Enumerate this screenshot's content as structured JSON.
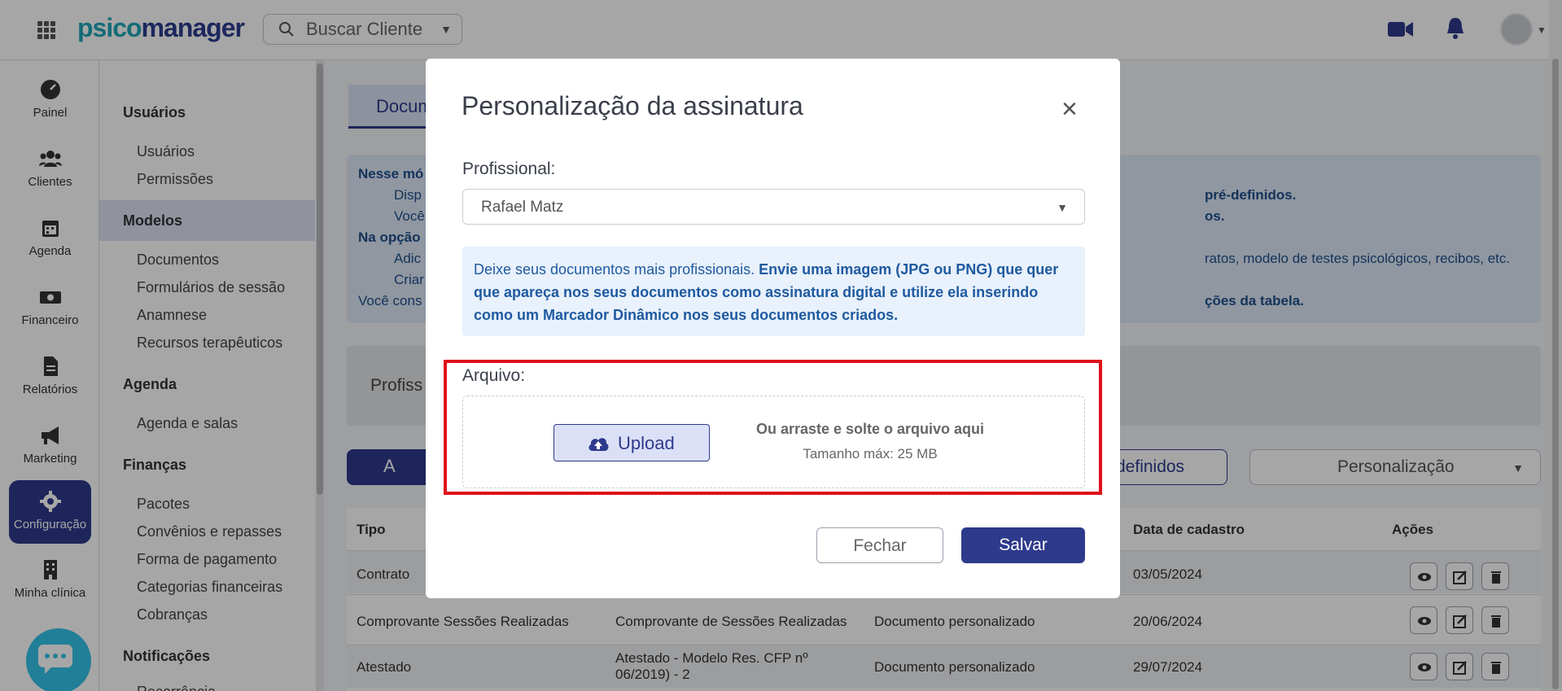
{
  "header": {
    "logo_part1": "psico",
    "logo_part2": "manager",
    "search_placeholder": "Buscar Cliente"
  },
  "rail": {
    "items": [
      {
        "label": "Painel",
        "icon": "dashboard-icon"
      },
      {
        "label": "Clientes",
        "icon": "users-icon"
      },
      {
        "label": "Agenda",
        "icon": "calendar-icon"
      },
      {
        "label": "Financeiro",
        "icon": "money-icon"
      },
      {
        "label": "Relatórios",
        "icon": "report-icon"
      },
      {
        "label": "Marketing",
        "icon": "megaphone-icon"
      },
      {
        "label": "Configuração",
        "icon": "gear-icon",
        "active": true
      },
      {
        "label": "Minha clínica",
        "icon": "building-icon"
      }
    ]
  },
  "menu": {
    "sections": [
      {
        "title": "Usuários",
        "links": [
          "Usuários",
          "Permissões"
        ]
      },
      {
        "title": "Modelos",
        "links": [
          "Documentos",
          "Formulários de sessão",
          "Anamnese",
          "Recursos terapêuticos"
        ]
      },
      {
        "title": "Agenda",
        "links": [
          "Agenda e salas"
        ]
      },
      {
        "title": "Finanças",
        "links": [
          "Pacotes",
          "Convênios e repasses",
          "Forma de pagamento",
          "Categorias financeiras",
          "Cobranças"
        ]
      },
      {
        "title": "Notificações",
        "links": [
          "Recorrência"
        ]
      }
    ]
  },
  "main": {
    "tab_label": "Docum",
    "info": {
      "line1": "Nesse mó",
      "bullet1": "Disp",
      "bullet1_end": "pré-definidos.",
      "bullet2": "Você",
      "bullet2_end": "os.",
      "line2": "Na opção",
      "bullet3": "Adic",
      "bullet3_end": "ratos, modelo de testes psicológicos, recibos, etc.",
      "bullet4": "Criar",
      "line3": "Você cons",
      "line3_end": "ções da tabela."
    },
    "prof_label": "Profiss",
    "add_button": "A",
    "predefined_button": "definidos",
    "personalize_button": "Personalização",
    "table": {
      "headers": {
        "tipo": "Tipo",
        "data": "Data de cadastro",
        "acoes": "Ações"
      },
      "rows": [
        {
          "tipo": "Contrato",
          "nome": "",
          "categoria": "",
          "data": "03/05/2024"
        },
        {
          "tipo": "Comprovante Sessões Realizadas",
          "nome": "Comprovante de Sessões Realizadas",
          "categoria": "Documento personalizado",
          "data": "20/06/2024"
        },
        {
          "tipo": "Atestado",
          "nome": "Atestado - Modelo Res. CFP nº 06/2019) - 2",
          "categoria": "Documento personalizado",
          "data": "29/07/2024"
        }
      ]
    }
  },
  "modal": {
    "title": "Personalização da assinatura",
    "professional_label": "Profissional:",
    "professional_value": "Rafael Matz",
    "info_normal": "Deixe seus documentos mais profissionais. ",
    "info_bold": "Envie uma imagem (JPG ou PNG) que quer que apareça nos seus documentos como assinatura digital e utilize ela inserindo como um Marcador Dinâmico nos seus documentos criados.",
    "file_label": "Arquivo:",
    "upload_button": "Upload",
    "drop_text": "Ou arraste e solte o arquivo aqui",
    "max_size": "Tamanho máx: 25 MB",
    "close_button": "Fechar",
    "save_button": "Salvar"
  },
  "colors": {
    "primary": "#2e3a8c",
    "accent": "#1fa6b8",
    "info_bg": "#e8f1fc",
    "highlight": "#e0101c"
  }
}
